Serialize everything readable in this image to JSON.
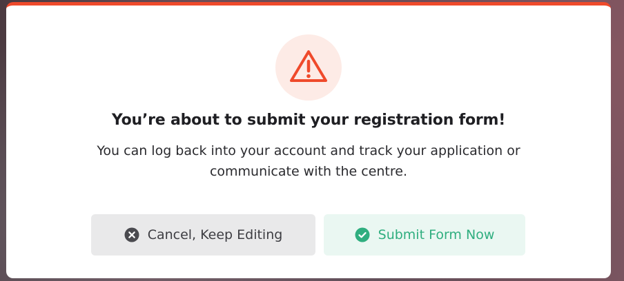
{
  "dialog": {
    "title": "You’re about to submit your registration form!",
    "message": "You can log back into your account and track your application or communicate with the centre.",
    "icon": "warning-triangle-icon",
    "accent_color": "#ef4a2b"
  },
  "buttons": {
    "cancel_label": "Cancel, Keep Editing",
    "cancel_icon": "x-circle-icon",
    "submit_label": "Submit Form Now",
    "submit_icon": "check-circle-icon",
    "submit_color": "#2fae7f"
  }
}
